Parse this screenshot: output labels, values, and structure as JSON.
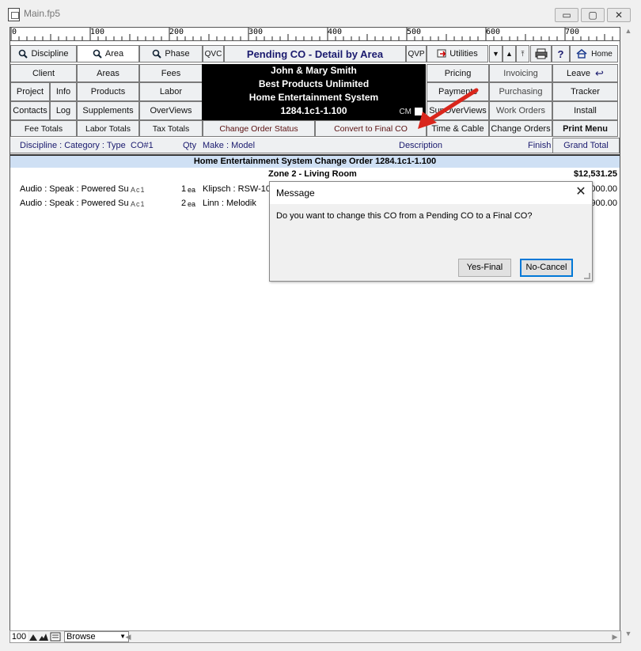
{
  "window": {
    "title": "Main.fp5",
    "minimize": "▭",
    "restore": "▢",
    "close": "✕"
  },
  "ruler": {
    "labels": [
      "0",
      "100",
      "200",
      "300",
      "400",
      "500",
      "600",
      "700"
    ]
  },
  "toolbar": {
    "discipline": "Discipline",
    "area": "Area",
    "phase": "Phase",
    "qvc": "QVC",
    "page_title": "Pending CO - Detail by Area",
    "qvp": "QVP",
    "utilities": "Utilities",
    "help": "?",
    "home": "Home"
  },
  "nav": {
    "client": "Client",
    "areas": "Areas",
    "fees": "Fees",
    "project": "Project",
    "info": "Info",
    "products": "Products",
    "labor": "Labor",
    "contacts": "Contacts",
    "log": "Log",
    "supplements": "Supplements",
    "overviews": "OverViews",
    "pricing": "Pricing",
    "invoicing": "Invoicing",
    "leave": "Leave",
    "payments": "Payments",
    "purchasing": "Purchasing",
    "tracker": "Tracker",
    "supoverviews": "SupOverViews",
    "work_orders": "Work Orders",
    "install": "Install",
    "fee_totals": "Fee Totals",
    "labor_totals": "Labor Totals",
    "tax_totals": "Tax Totals",
    "change_order_status": "Change Order Status",
    "convert_final": "Convert to Final CO",
    "time_cable": "Time & Cable",
    "change_orders": "Change Orders",
    "print_menu": "Print Menu"
  },
  "info_box": {
    "client": "John & Mary Smith",
    "company": "Best Products Unlimited",
    "system": "Home Entertainment System",
    "co_number": "1284.1c1-1.100",
    "cm": "CM"
  },
  "columns": {
    "category": "Discipline : Category : Type",
    "co": "CO#1",
    "qty": "Qty",
    "make": "Make : Model",
    "description": "Description",
    "finish": "Finish",
    "grand_total": "Grand Total"
  },
  "co_title": "Home Entertainment System Change Order 1284.1c1-1.100",
  "zone": {
    "name": "Zone 2 - Living Room",
    "total": "$12,531.25"
  },
  "rows": [
    {
      "category": "Audio : Speak : Powered Su",
      "ac": "Ac1",
      "qty": "1",
      "unit": "ea",
      "make": "Klipsch : RSW-10",
      "total": "000.00"
    },
    {
      "category": "Audio : Speak : Powered Su",
      "ac": "Ac1",
      "qty": "2",
      "unit": "ea",
      "make": "Linn : Melodik",
      "total": "900.00"
    }
  ],
  "dialog": {
    "title": "Message",
    "message": "Do you want to change this CO from a Pending CO to a Final CO?",
    "yes": "Yes-Final",
    "no": "No-Cancel",
    "close": "✕"
  },
  "statusbar": {
    "zoom": "100",
    "mode": "Browse"
  },
  "colors": {
    "accent_red": "#d9261c",
    "header_text": "#1a1a6e",
    "co_band": "#cfe0f4"
  }
}
